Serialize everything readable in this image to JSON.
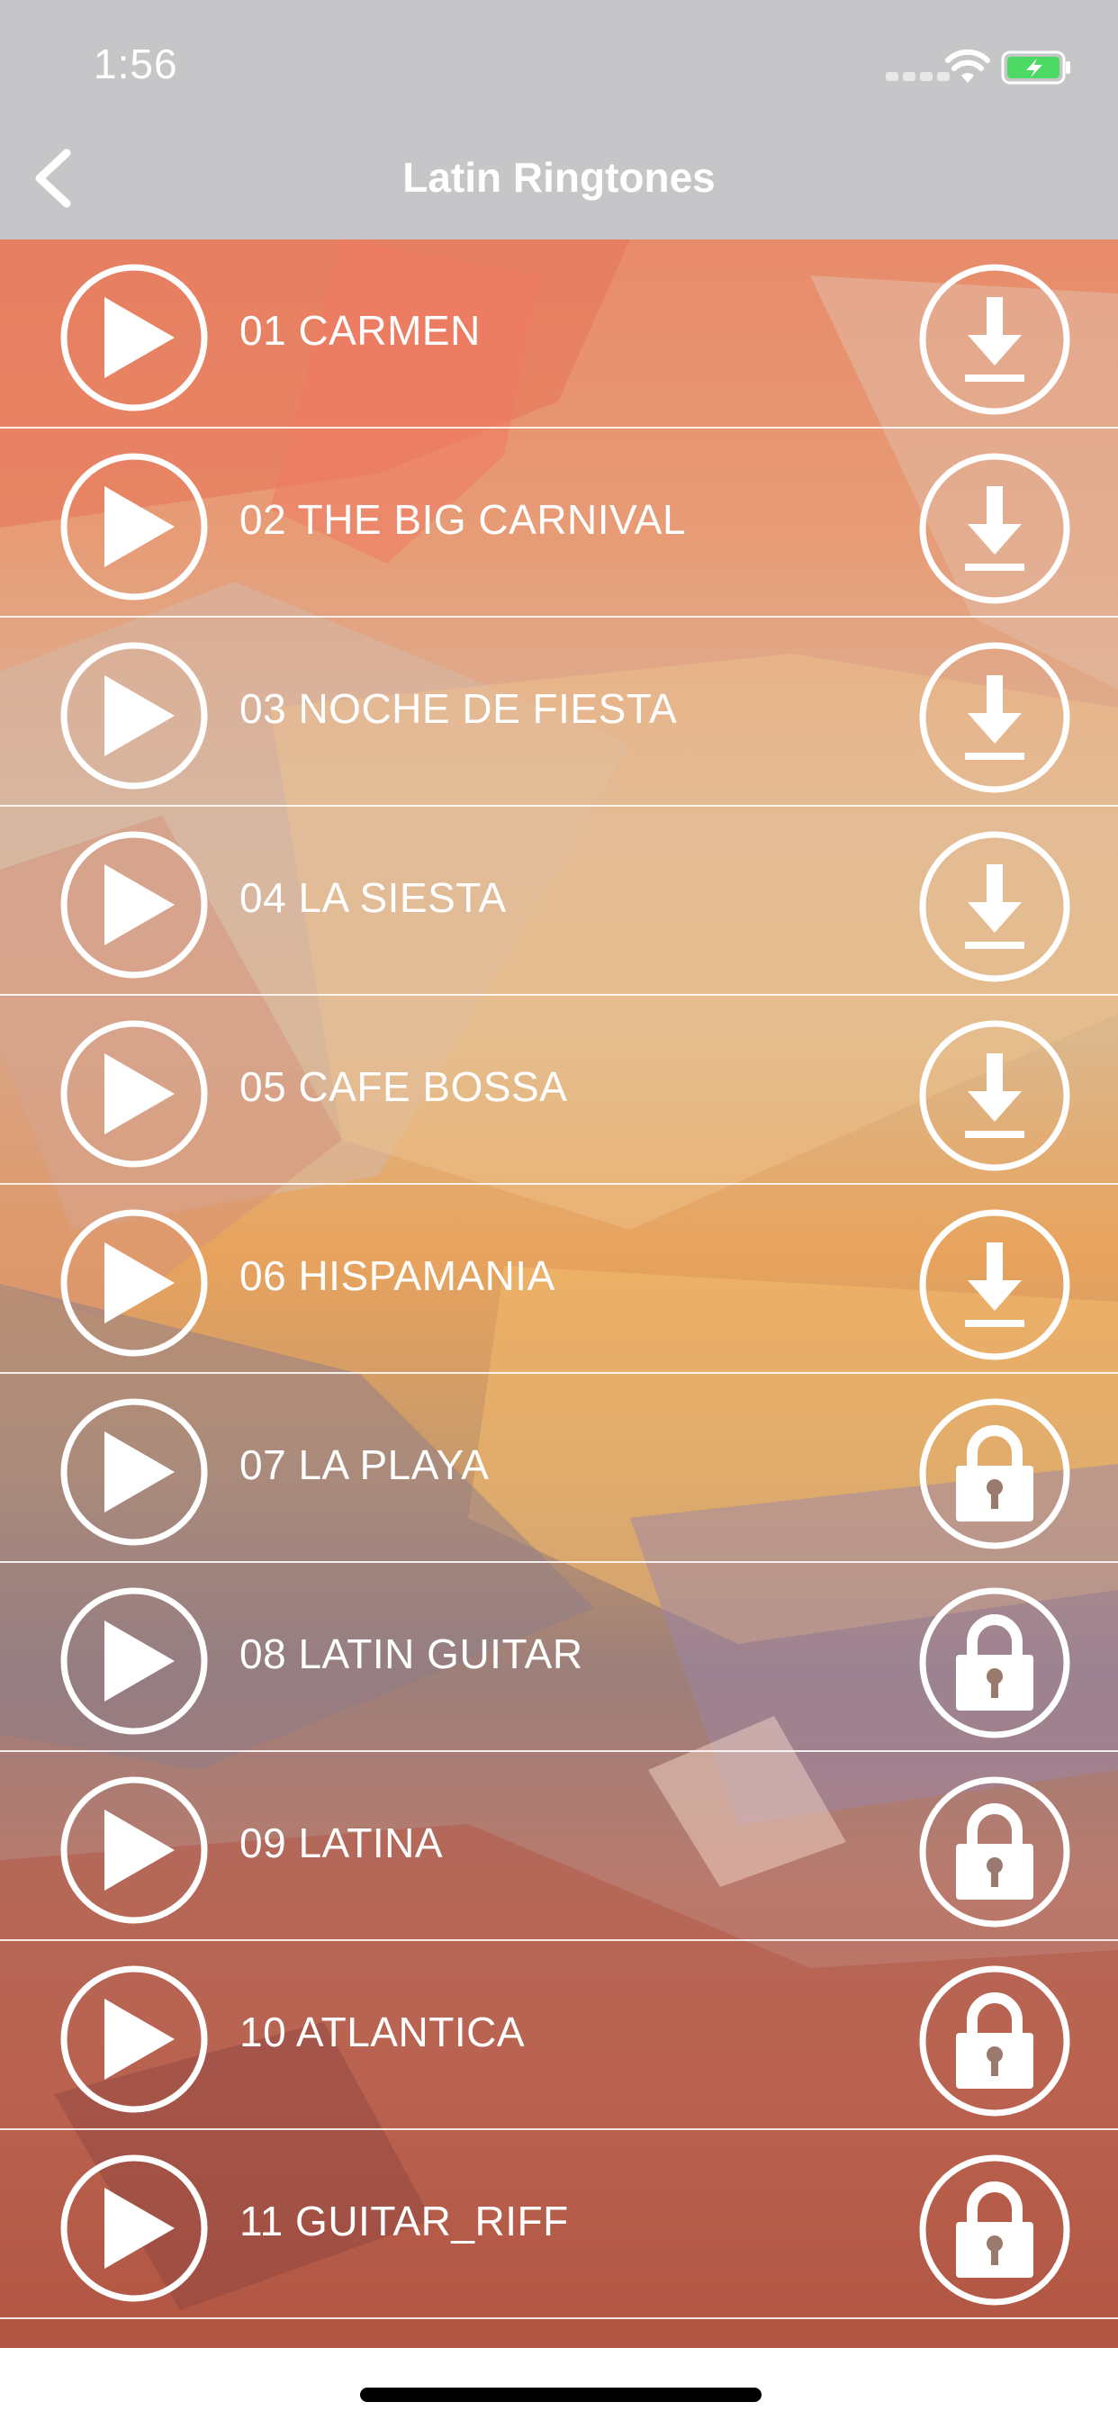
{
  "status_bar": {
    "time": "1:56"
  },
  "nav": {
    "title": "Latin Ringtones",
    "back_icon": "chevron-left-icon"
  },
  "songs": [
    {
      "title": "01 CARMEN",
      "action": "download"
    },
    {
      "title": "02 THE BIG CARNIVAL",
      "action": "download"
    },
    {
      "title": "03 NOCHE DE FIESTA",
      "action": "download"
    },
    {
      "title": "04 LA SIESTA",
      "action": "download"
    },
    {
      "title": "05 CAFE BOSSA",
      "action": "download"
    },
    {
      "title": "06 HISPAMANIA",
      "action": "download"
    },
    {
      "title": "07 LA PLAYA",
      "action": "locked"
    },
    {
      "title": "08 LATIN GUITAR",
      "action": "locked"
    },
    {
      "title": "09 LATINA",
      "action": "locked"
    },
    {
      "title": "10 ATLANTICA",
      "action": "locked"
    },
    {
      "title": "11 GUITAR_RIFF",
      "action": "locked"
    }
  ],
  "colors": {
    "nav_bar": "#c6c6c8",
    "battery_fill": "#4cd964",
    "text": "#ffffff"
  }
}
